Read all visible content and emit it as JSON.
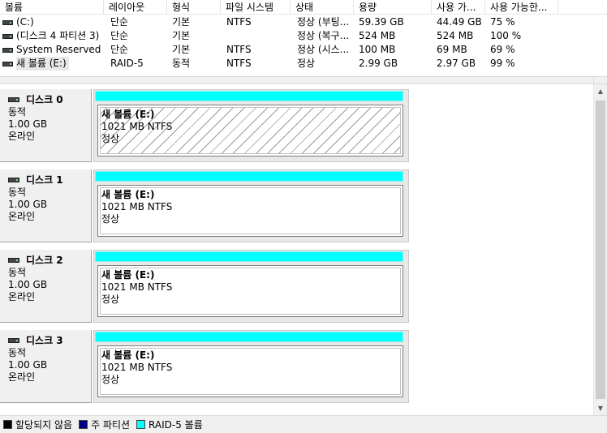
{
  "columns": [
    "볼륨",
    "레이아웃",
    "형식",
    "파일 시스템",
    "상태",
    "용량",
    "사용 가...",
    "사용 가능한..."
  ],
  "volumes": [
    {
      "name": "(C:)",
      "layout": "단순",
      "type": "기본",
      "fs": "NTFS",
      "status": "정상 (부팅...",
      "capacity": "59.39 GB",
      "free": "44.49 GB",
      "pct": "75 %"
    },
    {
      "name": "(디스크 4 파티션 3)",
      "layout": "단순",
      "type": "기본",
      "fs": "",
      "status": "정상 (복구...",
      "capacity": "524 MB",
      "free": "524 MB",
      "pct": "100 %"
    },
    {
      "name": "System Reserved",
      "layout": "단순",
      "type": "기본",
      "fs": "NTFS",
      "status": "정상 (시스...",
      "capacity": "100 MB",
      "free": "69 MB",
      "pct": "69 %"
    },
    {
      "name": "새 볼륨 (E:)",
      "layout": "RAID-5",
      "type": "동적",
      "fs": "NTFS",
      "status": "정상",
      "capacity": "2.99 GB",
      "free": "2.97 GB",
      "pct": "99 %"
    }
  ],
  "disks": [
    {
      "title": "디스크 0",
      "type": "동적",
      "size": "1.00 GB",
      "state": "온라인",
      "volume": {
        "name": "새 볼륨  (E:)",
        "size_fs": "1021 MB NTFS",
        "status": "정상",
        "selected": true
      }
    },
    {
      "title": "디스크 1",
      "type": "동적",
      "size": "1.00 GB",
      "state": "온라인",
      "volume": {
        "name": "새 볼륨  (E:)",
        "size_fs": "1021 MB NTFS",
        "status": "정상",
        "selected": false
      }
    },
    {
      "title": "디스크 2",
      "type": "동적",
      "size": "1.00 GB",
      "state": "온라인",
      "volume": {
        "name": "새 볼륨  (E:)",
        "size_fs": "1021 MB NTFS",
        "status": "정상",
        "selected": false
      }
    },
    {
      "title": "디스크 3",
      "type": "동적",
      "size": "1.00 GB",
      "state": "온라인",
      "volume": {
        "name": "새 볼륨  (E:)",
        "size_fs": "1021 MB NTFS",
        "status": "정상",
        "selected": false
      }
    }
  ],
  "legend": [
    {
      "label": "할당되지 않음",
      "color": "#000000"
    },
    {
      "label": "주 파티션",
      "color": "#000080"
    },
    {
      "label": "RAID-5 볼륨",
      "color": "#00ffff"
    }
  ],
  "scrollbar": {
    "up": "▲",
    "down": "▼"
  }
}
